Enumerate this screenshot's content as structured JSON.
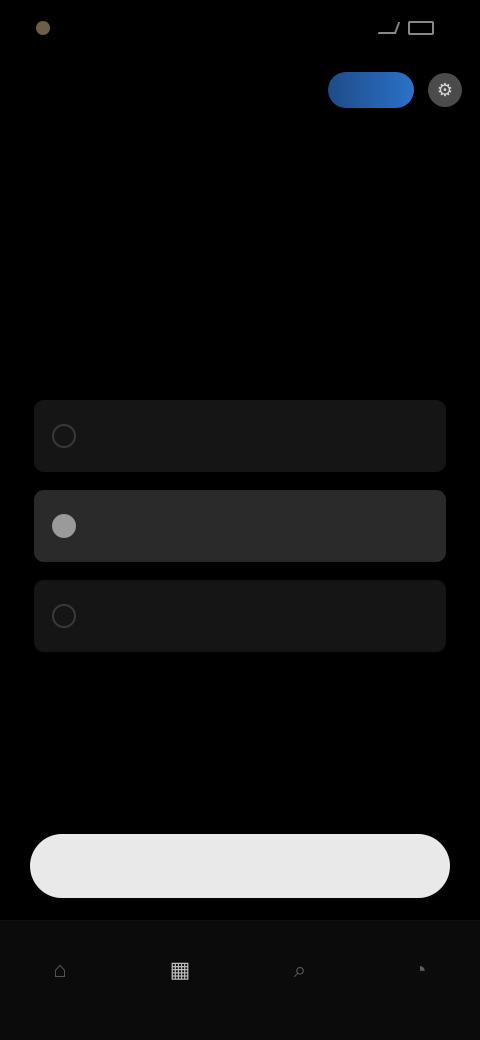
{
  "status_bar": {
    "time": "",
    "right_text": ""
  },
  "header": {
    "brand": "",
    "pro_badge_label": "",
    "settings_icon": "gear-icon"
  },
  "intro": {
    "title": "",
    "subtitle": ""
  },
  "options": [
    {
      "label": "",
      "selected": false
    },
    {
      "label": "",
      "selected": true
    },
    {
      "label": "",
      "selected": false
    }
  ],
  "primary_button": {
    "label": ""
  },
  "bottom_nav": [
    {
      "label": "",
      "icon": "home-icon",
      "active": false
    },
    {
      "label": "",
      "icon": "grid-icon",
      "active": true
    },
    {
      "label": "",
      "icon": "search-icon",
      "active": false
    },
    {
      "label": "",
      "icon": "profile-icon",
      "active": false
    }
  ],
  "colors": {
    "accent_blue": "#2a72c8",
    "background": "#000000",
    "primary_button_bg": "#e9e9e9"
  }
}
